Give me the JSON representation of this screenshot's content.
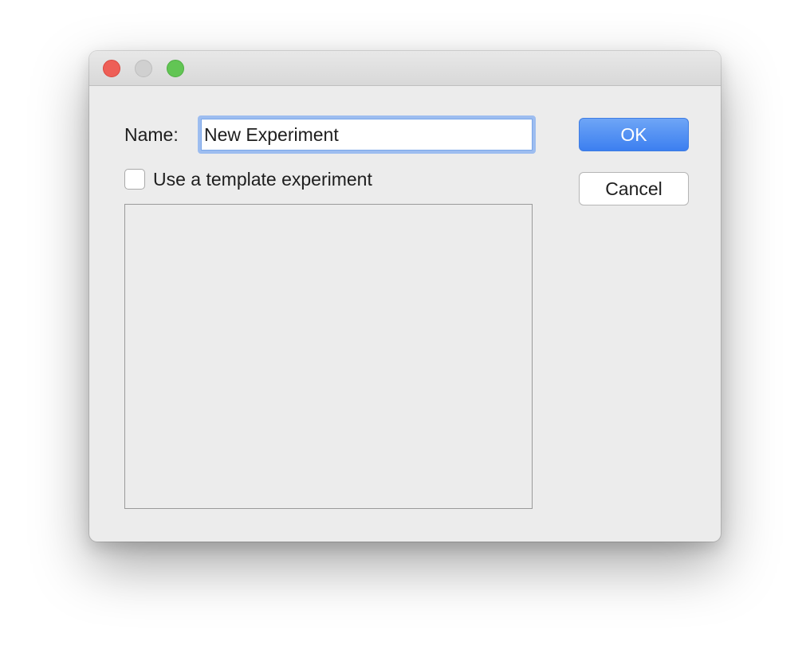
{
  "dialog": {
    "name_label": "Name:",
    "name_value": "New Experiment",
    "template_checkbox_label": "Use a template experiment",
    "template_checkbox_checked": false,
    "ok_label": "OK",
    "cancel_label": "Cancel",
    "template_list_items": []
  },
  "colors": {
    "accent": "#3c7ff0",
    "close_light": "#ee5f57",
    "minimize_light": "#d0d0d0",
    "zoom_light": "#62c554"
  }
}
